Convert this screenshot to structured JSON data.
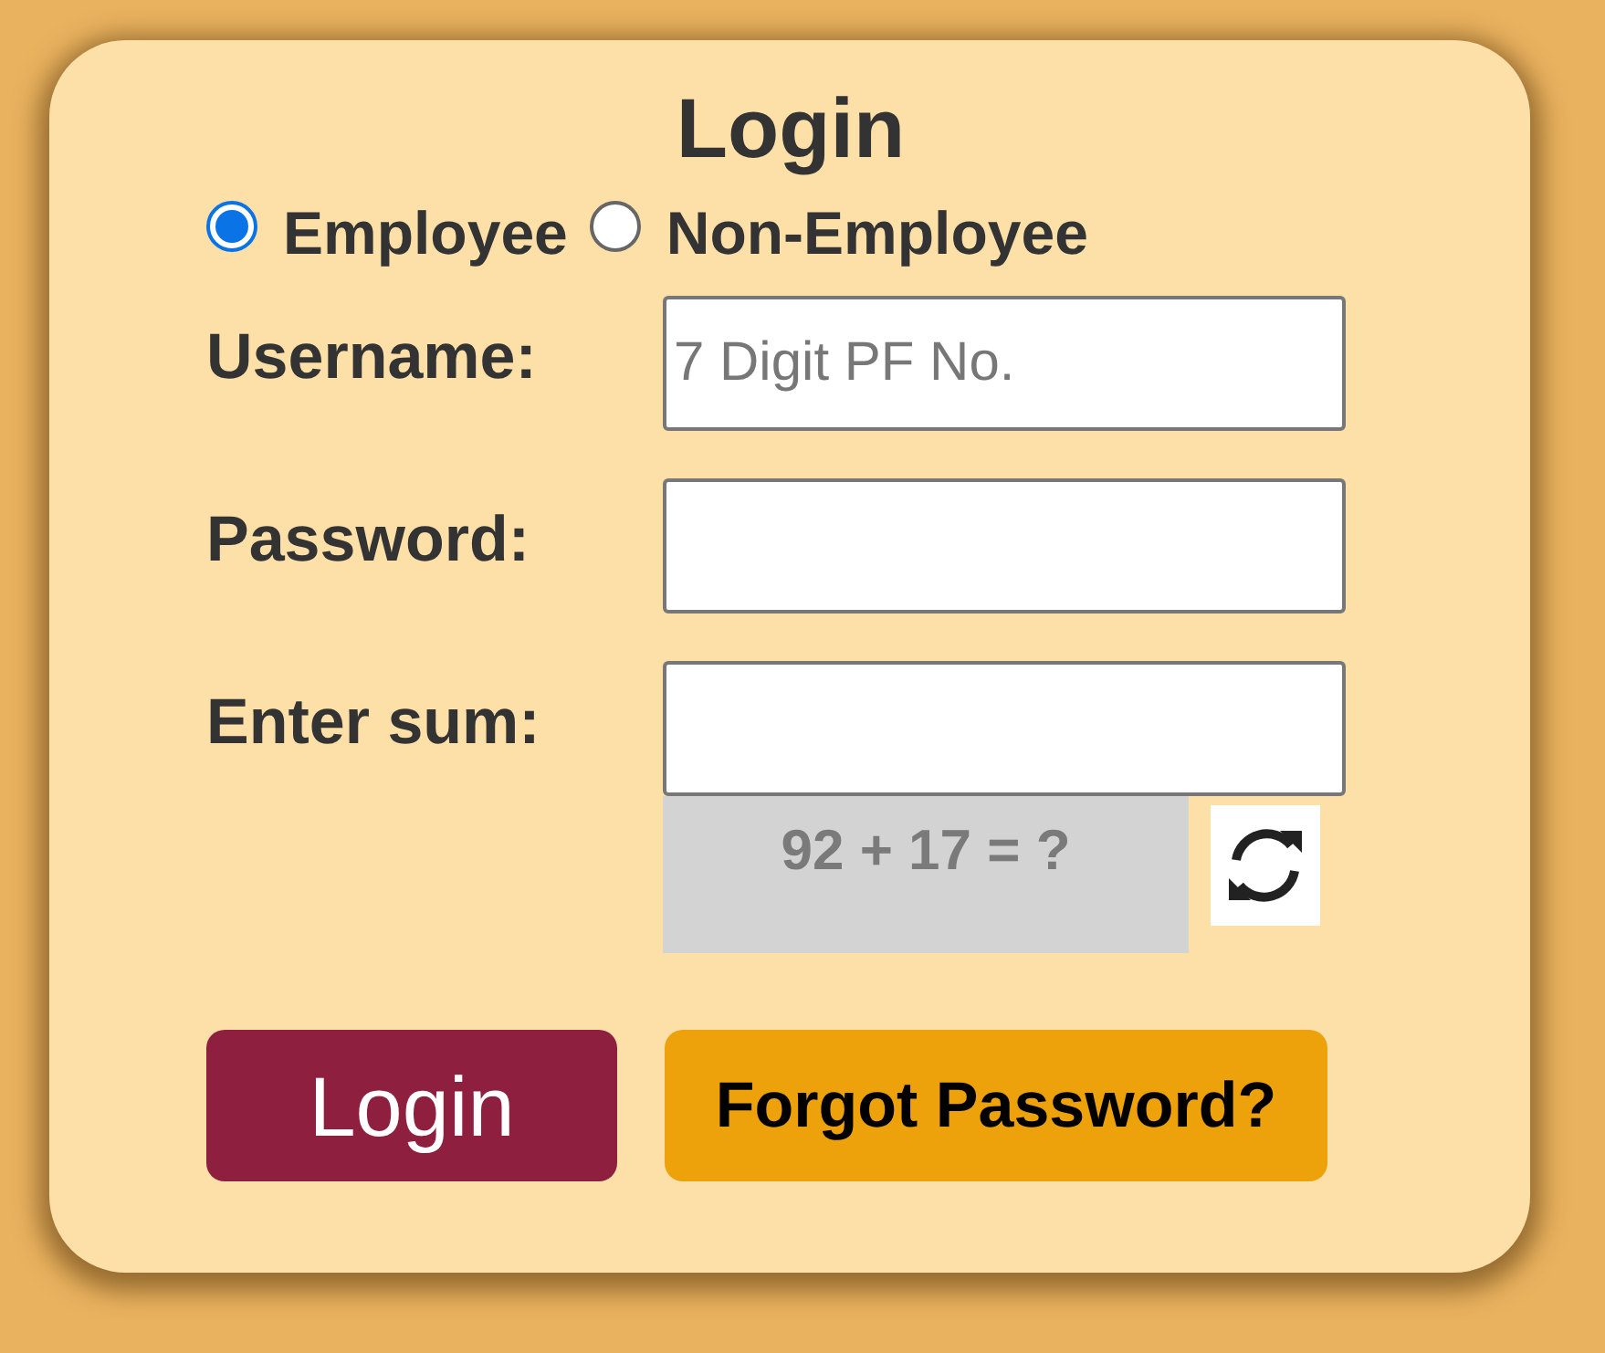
{
  "title": "Login",
  "roles": [
    {
      "label": "Employee",
      "selected": true
    },
    {
      "label": "Non-Employee",
      "selected": false
    }
  ],
  "fields": [
    {
      "label": "Username:",
      "placeholder": "7 Digit PF No."
    },
    {
      "label": "Password:"
    },
    {
      "label": "Enter sum:"
    }
  ],
  "captcha": {
    "text": "92 + 17 = ?"
  },
  "buttons": [
    {
      "label": "Login",
      "kind": "primary"
    },
    {
      "label": "Forgot Password?",
      "kind": "secondary"
    }
  ]
}
